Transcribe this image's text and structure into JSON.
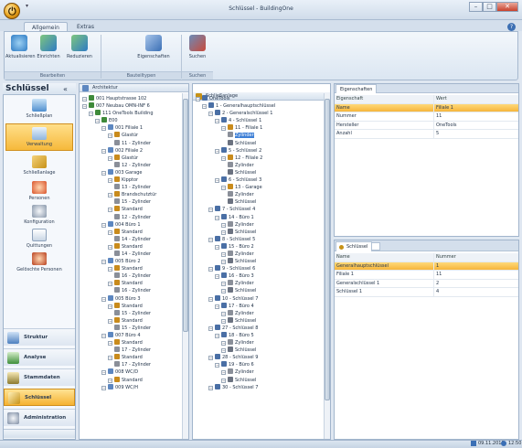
{
  "window": {
    "title": "Schlüssel - BuildingOne",
    "qat": "▾"
  },
  "tabs": [
    {
      "label": "Allgemein"
    },
    {
      "label": "Extras"
    }
  ],
  "ribbon": {
    "buttons": [
      {
        "label": "Aktualisieren"
      },
      {
        "label": "Einrichten"
      },
      {
        "label": "Reduzieren"
      },
      {
        "label": "Eigenschaften"
      },
      {
        "label": "Suchen"
      }
    ],
    "groups": [
      {
        "label": "Bearbeiten"
      },
      {
        "label": "Bauteiltypen"
      },
      {
        "label": "Suchen"
      }
    ]
  },
  "sidebar": {
    "title": "Schlüssel",
    "collapse": "«",
    "items": [
      {
        "label": "Schließplan"
      },
      {
        "label": "Verwaltung"
      },
      {
        "label": "Schließanlage"
      },
      {
        "label": "Personen"
      },
      {
        "label": "Konfiguration"
      },
      {
        "label": "Quittungen"
      },
      {
        "label": "Gelöschte Personen"
      }
    ],
    "nav": [
      {
        "label": "Struktur"
      },
      {
        "label": "Analyse"
      },
      {
        "label": "Stammdaten"
      },
      {
        "label": "Schlüssel"
      },
      {
        "label": "Administration"
      }
    ]
  },
  "left_tree": {
    "title": "Architektur",
    "nodes": [
      {
        "t": "001 Hauptstrasse 102",
        "d": 0
      },
      {
        "t": "007 Neubau OMN-INF 6",
        "d": 0
      },
      {
        "t": "111 OneTools Building",
        "d": 1
      },
      {
        "t": "E00",
        "d": 2
      },
      {
        "t": "001 Filiale 1",
        "d": 3
      },
      {
        "t": "Glastür",
        "d": 4
      },
      {
        "t": "11 - Zylinder",
        "d": 5
      },
      {
        "t": "002 Filiale 2",
        "d": 3
      },
      {
        "t": "Glastür",
        "d": 4
      },
      {
        "t": "12 - Zylinder",
        "d": 5
      },
      {
        "t": "003 Garage",
        "d": 3
      },
      {
        "t": "Kipptor",
        "d": 4
      },
      {
        "t": "13 - Zylinder",
        "d": 5
      },
      {
        "t": "Brandschutztür",
        "d": 4
      },
      {
        "t": "15 - Zylinder",
        "d": 5
      },
      {
        "t": "Standard",
        "d": 4
      },
      {
        "t": "12 - Zylinder",
        "d": 5
      },
      {
        "t": "004 Büro 1",
        "d": 3
      },
      {
        "t": "Standard",
        "d": 4
      },
      {
        "t": "14 - Zylinder",
        "d": 5
      },
      {
        "t": "Standard",
        "d": 4
      },
      {
        "t": "14 - Zylinder",
        "d": 5
      },
      {
        "t": "005 Büro 2",
        "d": 3
      },
      {
        "t": "Standard",
        "d": 4
      },
      {
        "t": "16 - Zylinder",
        "d": 5
      },
      {
        "t": "Standard",
        "d": 4
      },
      {
        "t": "16 - Zylinder",
        "d": 5
      },
      {
        "t": "005 Büro 3",
        "d": 3
      },
      {
        "t": "Standard",
        "d": 4
      },
      {
        "t": "15 - Zylinder",
        "d": 5
      },
      {
        "t": "Standard",
        "d": 4
      },
      {
        "t": "15 - Zylinder",
        "d": 5
      },
      {
        "t": "007 Büro 4",
        "d": 3
      },
      {
        "t": "Standard",
        "d": 4
      },
      {
        "t": "17 - Zylinder",
        "d": 5
      },
      {
        "t": "Standard",
        "d": 4
      },
      {
        "t": "17 - Zylinder",
        "d": 5
      },
      {
        "t": "008 WC/D",
        "d": 3
      },
      {
        "t": "Standard",
        "d": 4
      },
      {
        "t": "009 WC/H",
        "d": 3
      }
    ]
  },
  "mid_tree": {
    "title": "Schließanlage",
    "nodes": [
      {
        "t": "OneTools",
        "d": 0
      },
      {
        "t": "1 - Generalhauptschlüssel",
        "d": 1
      },
      {
        "t": "2 - Generalschlüssel 1",
        "d": 2
      },
      {
        "t": "4 - Schlüssel 1",
        "d": 3
      },
      {
        "t": "11 - Filiale 1",
        "d": 4
      },
      {
        "t": "Zylinder",
        "d": 5,
        "sel": true
      },
      {
        "t": "Schlüssel",
        "d": 5
      },
      {
        "t": "5 - Schlüssel 2",
        "d": 3
      },
      {
        "t": "12 - Filiale 2",
        "d": 4
      },
      {
        "t": "Zylinder",
        "d": 5
      },
      {
        "t": "Schlüssel",
        "d": 5
      },
      {
        "t": "6 - Schlüssel 3",
        "d": 3
      },
      {
        "t": "13 - Garage",
        "d": 4
      },
      {
        "t": "Zylinder",
        "d": 5
      },
      {
        "t": "Schlüssel",
        "d": 5
      },
      {
        "t": "7 - Schlüssel 4",
        "d": 2
      },
      {
        "t": "14 - Büro 1",
        "d": 3
      },
      {
        "t": "Zylinder",
        "d": 4
      },
      {
        "t": "Schlüssel",
        "d": 4
      },
      {
        "t": "8 - Schlüssel 5",
        "d": 2
      },
      {
        "t": "15 - Büro 2",
        "d": 3
      },
      {
        "t": "Zylinder",
        "d": 4
      },
      {
        "t": "Schlüssel",
        "d": 4
      },
      {
        "t": "9 - Schlüssel 6",
        "d": 2
      },
      {
        "t": "16 - Büro 3",
        "d": 3
      },
      {
        "t": "Zylinder",
        "d": 4
      },
      {
        "t": "Schlüssel",
        "d": 4
      },
      {
        "t": "10 - Schlüssel 7",
        "d": 2
      },
      {
        "t": "17 - Büro 4",
        "d": 3
      },
      {
        "t": "Zylinder",
        "d": 4
      },
      {
        "t": "Schlüssel",
        "d": 4
      },
      {
        "t": "27 - Schlüssel 8",
        "d": 2
      },
      {
        "t": "18 - Büro 5",
        "d": 3
      },
      {
        "t": "Zylinder",
        "d": 4
      },
      {
        "t": "Schlüssel",
        "d": 4
      },
      {
        "t": "28 - Schlüssel 9",
        "d": 2
      },
      {
        "t": "19 - Büro 6",
        "d": 3
      },
      {
        "t": "Zylinder",
        "d": 4
      },
      {
        "t": "Schlüssel",
        "d": 4
      },
      {
        "t": "30 - Schlüssel 7",
        "d": 2
      }
    ]
  },
  "properties": {
    "tab": "Eigenschaften",
    "headers": {
      "name": "Eigenschaft",
      "value": "Wert"
    },
    "rows": [
      {
        "name": "Name",
        "value": "Filiale 1",
        "hl": true
      },
      {
        "name": "Nummer",
        "value": "11"
      },
      {
        "name": "Hersteller",
        "value": "OneTools"
      },
      {
        "name": "Anzahl",
        "value": "5"
      }
    ]
  },
  "keys": {
    "tab": "Schlüssel",
    "headers": {
      "name": "Name",
      "value": "Nummer"
    },
    "rows": [
      {
        "name": "Generalhauptschlüssel",
        "value": "1",
        "hl": true
      },
      {
        "name": "Filiale 1",
        "value": "11"
      },
      {
        "name": "Generalschlüssel 1",
        "value": "2"
      },
      {
        "name": "Schlüssel 1",
        "value": "4"
      }
    ]
  },
  "status": {
    "date": "09.11.2011",
    "time": "12:50"
  },
  "colors": {
    "accent": "#f6b93b",
    "selection": "#3d7fd6",
    "frame": "#a2b5cc"
  }
}
